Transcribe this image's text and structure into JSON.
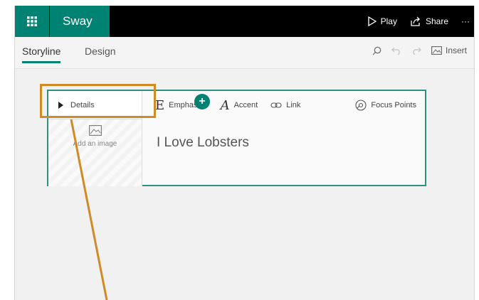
{
  "app": {
    "name": "Sway"
  },
  "topbar": {
    "play": "Play",
    "share": "Share",
    "more": "···"
  },
  "tabs": [
    {
      "label": "Storyline"
    },
    {
      "label": "Design"
    }
  ],
  "tools": {
    "insert": "Insert"
  },
  "card": {
    "details": "Details",
    "emphasize": "Emphasize",
    "accent": "Accent",
    "link": "Link",
    "focus_points": "Focus Points",
    "add_image": "Add an image",
    "title_text": "I Love Lobsters"
  },
  "colors": {
    "accent": "#008272",
    "annotation": "#d08a26"
  }
}
